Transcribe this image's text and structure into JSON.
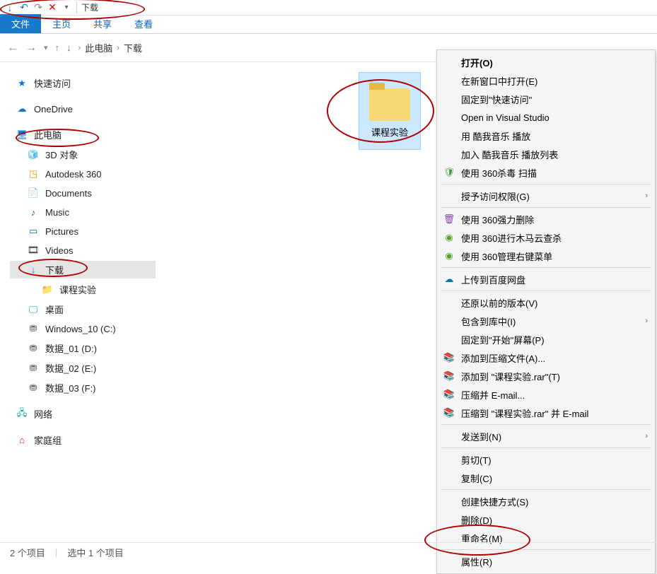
{
  "qat": {
    "title": "下载"
  },
  "ribbon": {
    "file": "文件",
    "home": "主页",
    "share": "共享",
    "view": "查看"
  },
  "breadcrumb": {
    "root": "此电脑",
    "folder": "下载"
  },
  "sidebar": {
    "quick_access": "快速访问",
    "onedrive": "OneDrive",
    "this_pc": "此电脑",
    "pc_children": {
      "3d": "3D 对象",
      "autodesk": "Autodesk 360",
      "documents": "Documents",
      "music": "Music",
      "pictures": "Pictures",
      "videos": "Videos",
      "downloads": "下载",
      "downloads_child": "课程实验",
      "desktop": "桌面",
      "win10": "Windows_10 (C:)",
      "d1": "数据_01 (D:)",
      "d2": "数据_02 (E:)",
      "d3": "数据_03 (F:)"
    },
    "network": "网络",
    "homegroup": "家庭组"
  },
  "content": {
    "folder": "课程实验"
  },
  "ctxmenu": {
    "open": "打开(O)",
    "open_new": "在新窗口中打开(E)",
    "pin_quick": "固定到\"快速访问\"",
    "open_vs": "Open in Visual Studio",
    "kuwo_play": "用 酷我音乐 播放",
    "kuwo_add": "加入 酷我音乐 播放列表",
    "360_scan": "使用 360杀毒 扫描",
    "grant_access": "授予访问权限(G)",
    "360_force_delete": "使用 360强力删除",
    "360_trojan": "使用 360进行木马云查杀",
    "360_rightmenu": "使用 360管理右键菜单",
    "baidu_upload": "上传到百度网盘",
    "restore_prev": "还原以前的版本(V)",
    "include_lib": "包含到库中(I)",
    "pin_start": "固定到\"开始\"屏幕(P)",
    "add_archive": "添加到压缩文件(A)...",
    "add_rar": "添加到 \"课程实验.rar\"(T)",
    "compress_email": "压缩并 E-mail...",
    "compress_rar_email": "压缩到 \"课程实验.rar\" 并 E-mail",
    "send_to": "发送到(N)",
    "cut": "剪切(T)",
    "copy": "复制(C)",
    "create_shortcut": "创建快捷方式(S)",
    "delete": "删除(D)",
    "rename": "重命名(M)",
    "properties": "属性(R)"
  },
  "statusbar": {
    "item_count": "2 个项目",
    "selected": "选中 1 个项目"
  }
}
